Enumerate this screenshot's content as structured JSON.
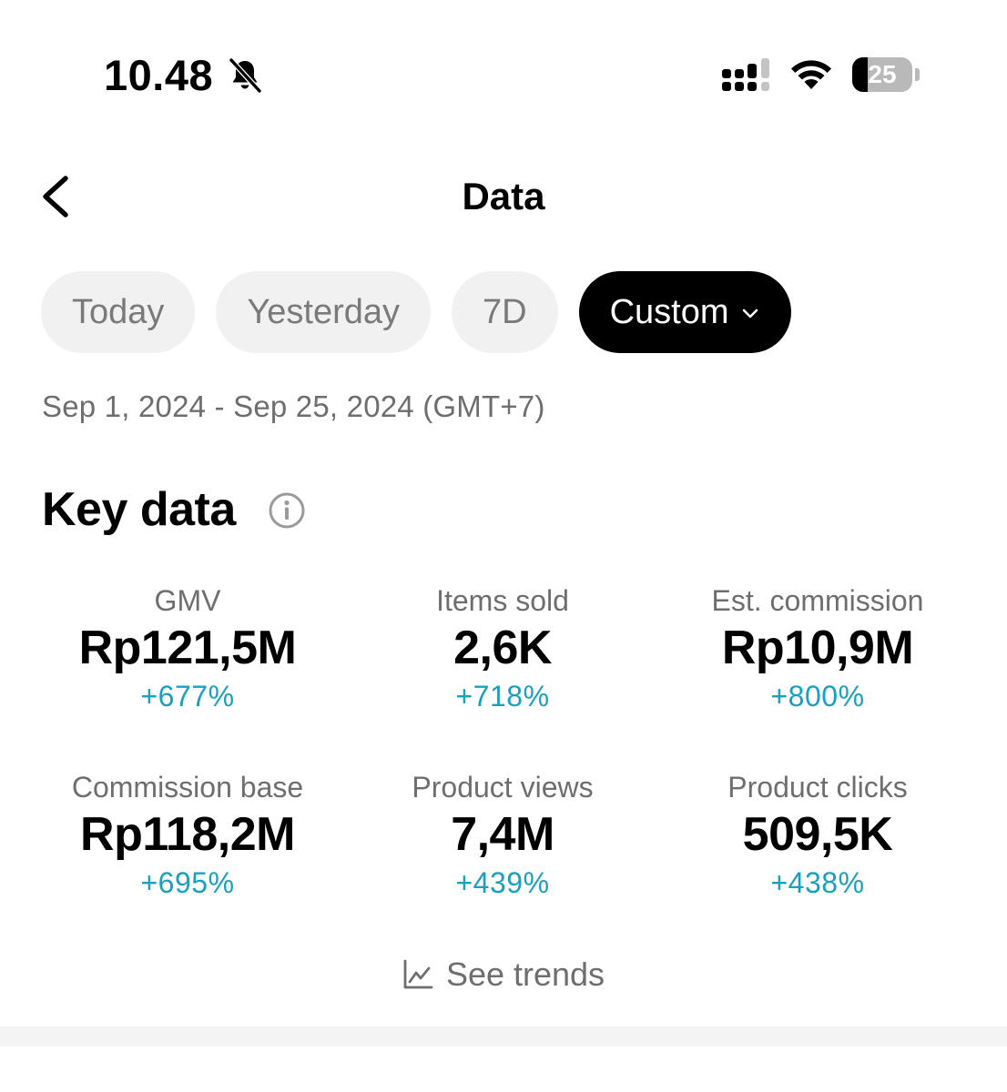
{
  "status_bar": {
    "time": "10.48",
    "battery_level": "25",
    "battery_fraction": 0.25,
    "icons": [
      "bell-slash-icon",
      "signal-icon",
      "wifi-icon",
      "battery-icon"
    ]
  },
  "header": {
    "title": "Data",
    "back_icon": "chevron-left-icon"
  },
  "filters": {
    "chips": [
      {
        "label": "Today",
        "active": false
      },
      {
        "label": "Yesterday",
        "active": false
      },
      {
        "label": "7D",
        "active": false
      },
      {
        "label": "Custom",
        "active": true
      }
    ],
    "date_range": "Sep 1, 2024 - Sep 25, 2024 (GMT+7)"
  },
  "key_data": {
    "title": "Key data",
    "info_icon": "info-icon",
    "metrics": [
      {
        "label": "GMV",
        "value": "Rp121,5M",
        "change": "+677%"
      },
      {
        "label": "Items sold",
        "value": "2,6K",
        "change": "+718%"
      },
      {
        "label": "Est. commission",
        "value": "Rp10,9M",
        "change": "+800%"
      },
      {
        "label": "Commission base",
        "value": "Rp118,2M",
        "change": "+695%"
      },
      {
        "label": "Product views",
        "value": "7,4M",
        "change": "+439%"
      },
      {
        "label": "Product clicks",
        "value": "509,5K",
        "change": "+438%"
      }
    ],
    "trends_label": "See trends",
    "trends_icon": "line-chart-icon"
  },
  "colors": {
    "accent_positive": "#1aa0bf",
    "chip_active_bg": "#000000",
    "chip_inactive_bg": "#f1f1f1",
    "muted_text": "#6e6e6e"
  }
}
